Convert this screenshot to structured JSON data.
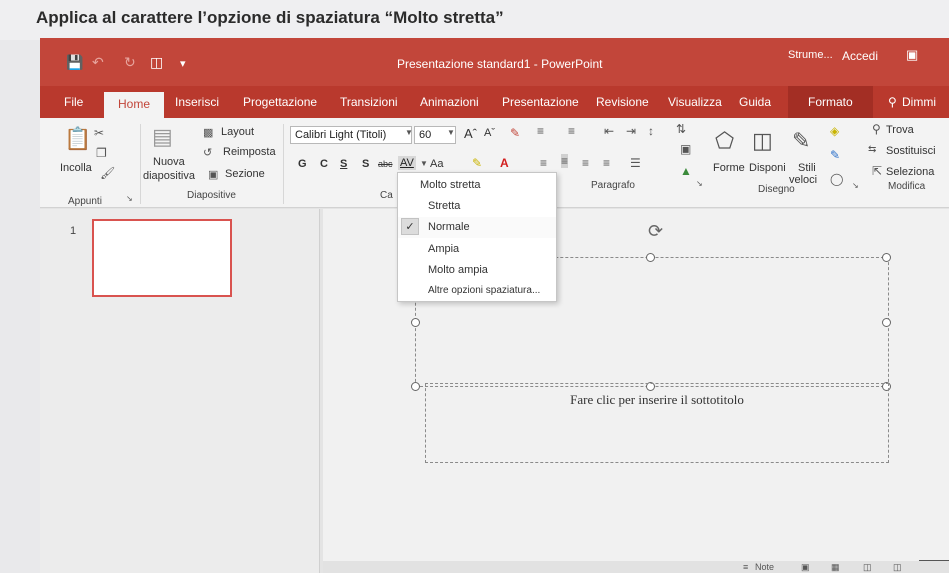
{
  "task": {
    "instruction": "Applica al carattere l’opzione di spaziatura “Molto stretta”"
  },
  "window": {
    "title": "Presentazione standard1  -  PowerPoint",
    "context_tab": "Strume...",
    "sign_in": "Accedi"
  },
  "tabs": [
    "File",
    "Home",
    "Inserisci",
    "Progettazione",
    "Transizioni",
    "Animazioni",
    "Presentazione",
    "Revisione",
    "Visualizza",
    "Guida",
    "Formato",
    "Dimmi"
  ],
  "ribbon": {
    "clipboard": {
      "paste": "Incolla",
      "group": "Appunti"
    },
    "slides": {
      "new_slide": "Nuova",
      "new_slide_2": "diapositiva",
      "layout": "Layout",
      "reset": "Reimposta",
      "section": "Sezione",
      "group": "Diapositive"
    },
    "font": {
      "name": "Calibri Light (Titoli)",
      "size": "60",
      "bold": "G",
      "italic": "C",
      "underline": "S",
      "shadow": "S",
      "strike": "abc",
      "spacing": "AV",
      "case": "Aa",
      "group_partial": "Ca"
    },
    "paragraph": {
      "group": "Paragrafo"
    },
    "drawing": {
      "shapes": "Forme",
      "arrange": "Disponi",
      "quick_styles": "Stili",
      "quick_styles_2": "veloci",
      "group": "Disegno"
    },
    "editing": {
      "find": "Trova",
      "replace": "Sostituisci",
      "select": "Seleziona",
      "group": "Modifica"
    }
  },
  "spacing_menu": {
    "items": [
      "Molto stretta",
      "Stretta",
      "Normale",
      "Ampia",
      "Molto ampia",
      "Altre opzioni spaziatura..."
    ],
    "checked": "Normale"
  },
  "slides_pane": {
    "slide_number": "1"
  },
  "slide": {
    "subtitle_placeholder": "Fare clic per inserire il sottotitolo"
  },
  "status": {
    "notes": "Note"
  },
  "colors": {
    "accent": "#c2463a"
  }
}
